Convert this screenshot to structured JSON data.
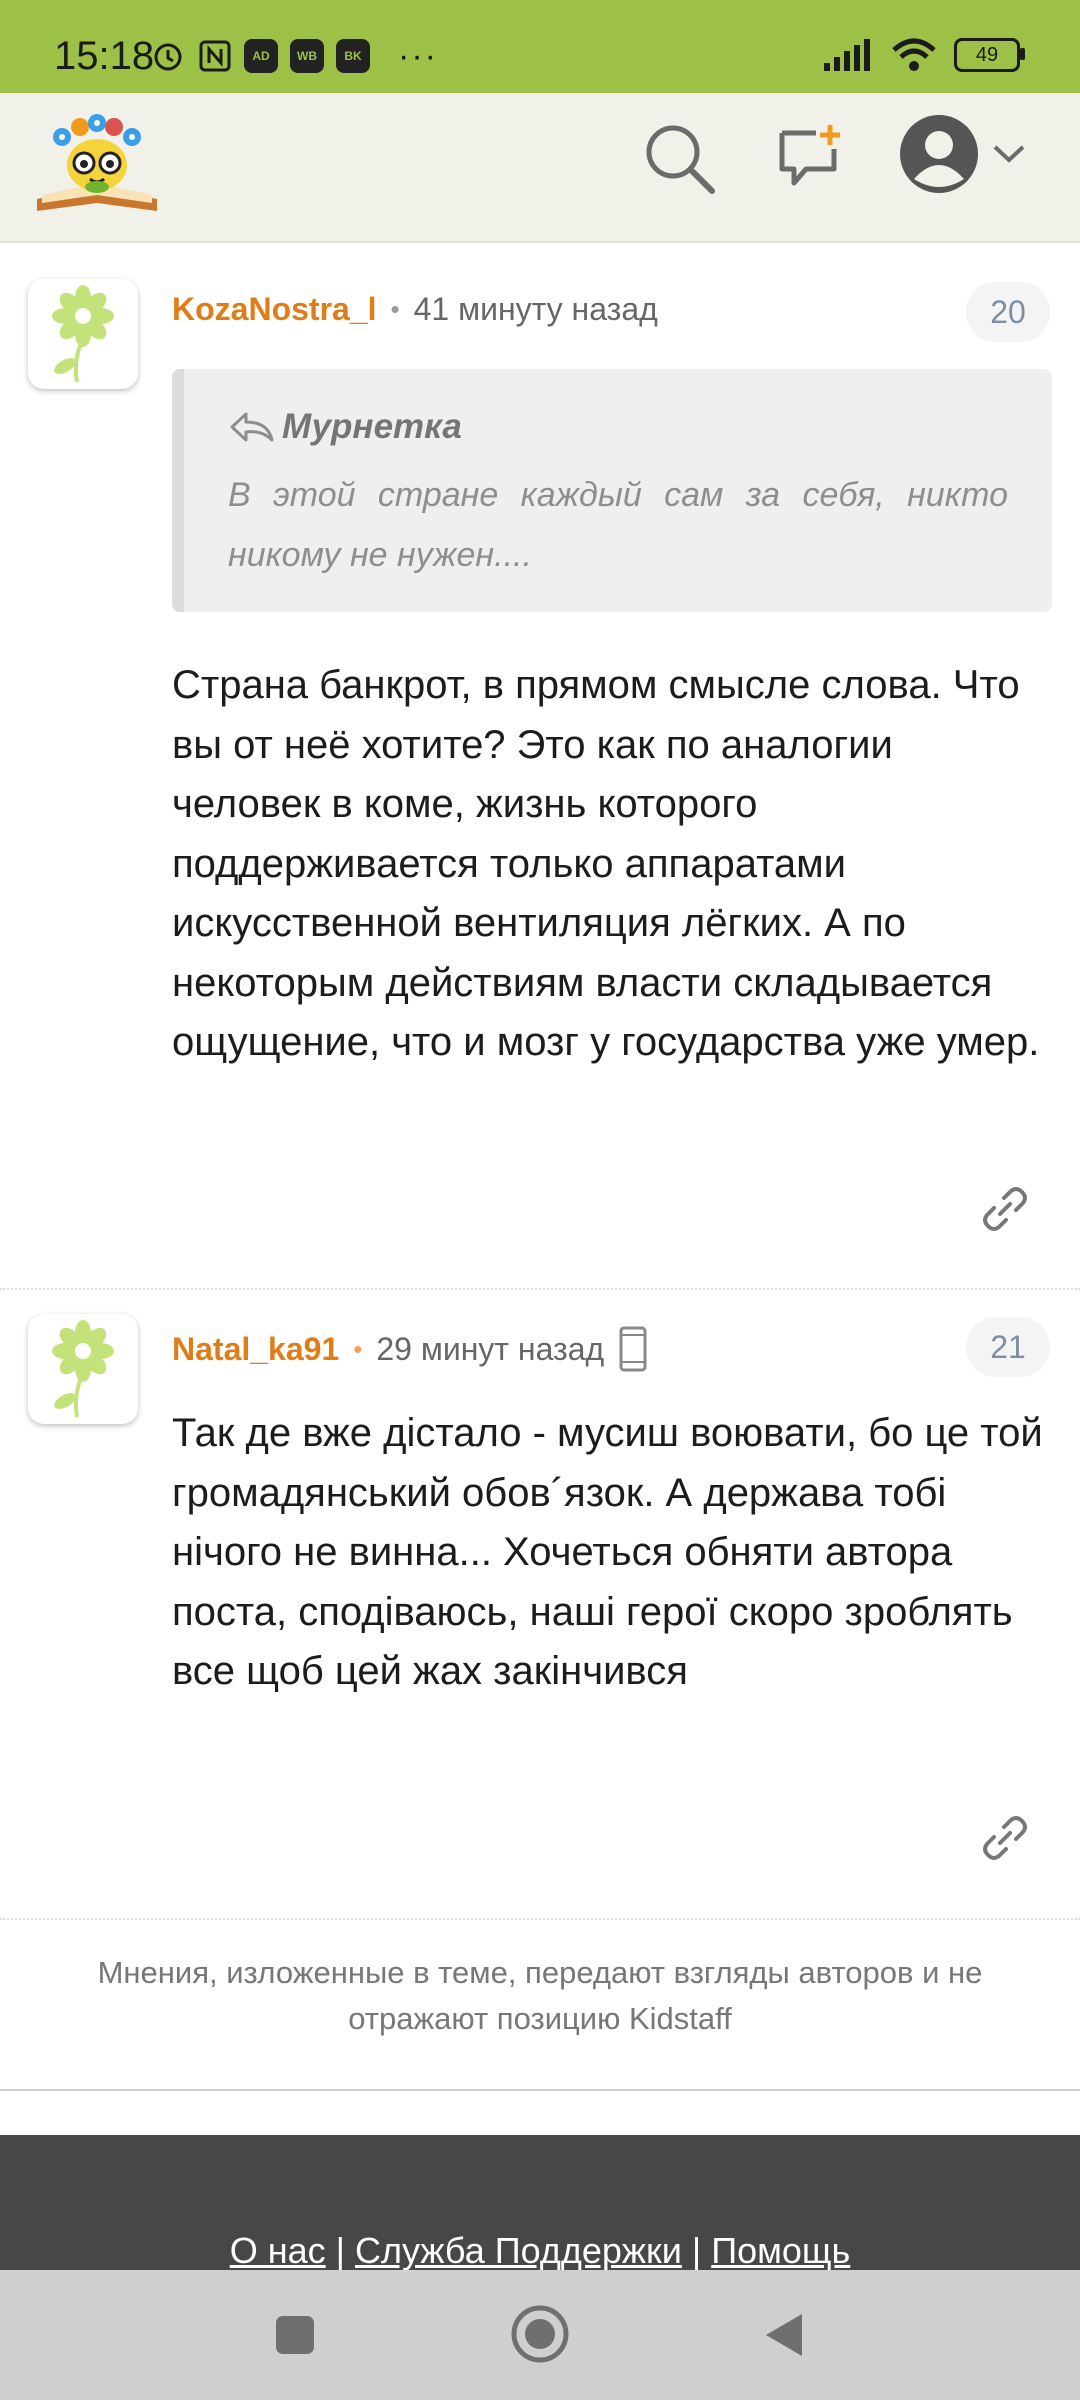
{
  "status_bar": {
    "time": "15:18",
    "notif_icons": [
      "AD",
      "WB",
      "BK"
    ],
    "more": "···",
    "battery": "49"
  },
  "header": {
    "logo": "kidstaff-logo",
    "icons": [
      "search-icon",
      "new-post-icon",
      "user-avatar-icon",
      "chevron-down-icon"
    ]
  },
  "posts": [
    {
      "author": "KozaNostra_l",
      "time": "41 минуту назад",
      "number": "20",
      "quote": {
        "author": "Мурнетка",
        "text": "В этой стране каждый сам за себя, никто никому не нужен...."
      },
      "text": "Страна банкрот, в прямом смысле слова. Что вы от неё хотите? Это как по аналогии человек в коме, жизнь которого поддерживается только аппаратами искусственной вентиляция лёгких. А по некоторым действиям власти складывается ощущение, что и мозг у государства уже умер."
    },
    {
      "author": "Natal_ka91",
      "time": "29 минут назад",
      "number": "21",
      "device_icon": "mobile-phone-icon",
      "text": "Так де вже дістало - мусиш воювати, бо це той громадянський обов´язок. А держава тобі нічого не винна... Хочеться обняти автора поста, сподіваюсь, наші герої скоро зроблять все щоб цей жах закінчився"
    }
  ],
  "disclaimer": "Мнения, изложенные в теме, передают взгляды авторов и не отражают позицию Kidstaff",
  "footer": {
    "links": [
      "О нас",
      "Служба Поддержки",
      "Помощь"
    ],
    "separator": "|"
  },
  "colors": {
    "status_bar": "#9dc146",
    "author": "#e07d16",
    "header_bg": "#f1f1ea",
    "footer_bg": "#474747"
  }
}
